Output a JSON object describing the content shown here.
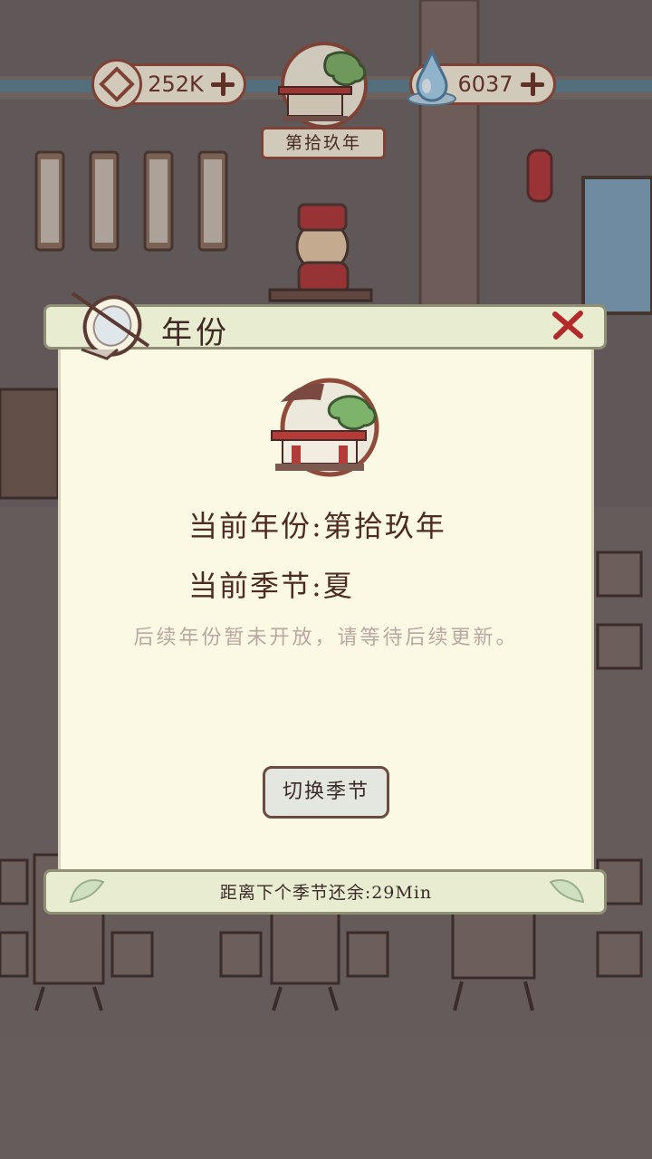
{
  "hud": {
    "coins": "252K",
    "spirit": "6037",
    "year_badge": "第拾玖年"
  },
  "modal": {
    "title": "年份",
    "current_year_label": "当前年份:",
    "current_year_value": "第拾玖年",
    "current_season_label": "当前季节:",
    "current_season_value": "夏",
    "notice": "后续年份暂未开放，请等待后续更新。",
    "switch_button": "切换季节",
    "countdown": "距离下个季节还余:29Min"
  },
  "colors": {
    "paper": "#fbf9e3",
    "accent": "#8f4a3a",
    "close": "#b32a2a"
  }
}
